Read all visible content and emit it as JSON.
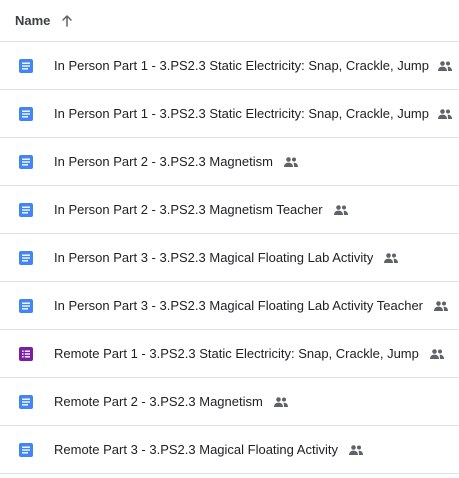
{
  "header": {
    "name_label": "Name",
    "sort_icon": "arrow-up-icon"
  },
  "colors": {
    "doc": "#4285f4",
    "form": "#7b1fa2",
    "shared": "#5f6368",
    "divider": "#e0e0e0"
  },
  "files": [
    {
      "name": "In Person Part 1 - 3.PS2.3 Static Electricity: Snap, Crackle, Jump",
      "type": "doc",
      "shared": true,
      "truncated": true
    },
    {
      "name": "In Person Part 1 - 3.PS2.3 Static Electricity: Snap, Crackle, Jump",
      "type": "doc",
      "shared": true,
      "truncated": true
    },
    {
      "name": "In Person Part 2 - 3.PS2.3 Magnetism",
      "type": "doc",
      "shared": true,
      "truncated": false
    },
    {
      "name": "In Person Part 2 - 3.PS2.3 Magnetism Teacher",
      "type": "doc",
      "shared": true,
      "truncated": false
    },
    {
      "name": "In Person Part 3 - 3.PS2.3 Magical Floating Lab Activity",
      "type": "doc",
      "shared": true,
      "truncated": false
    },
    {
      "name": "In Person Part 3 - 3.PS2.3 Magical Floating Lab Activity Teacher",
      "type": "doc",
      "shared": true,
      "truncated": false
    },
    {
      "name": "Remote Part 1 - 3.PS2.3 Static Electricity: Snap, Crackle, Jump",
      "type": "form",
      "shared": true,
      "truncated": false
    },
    {
      "name": "Remote Part 2 - 3.PS2.3 Magnetism",
      "type": "doc",
      "shared": true,
      "truncated": false
    },
    {
      "name": "Remote Part 3 - 3.PS2.3 Magical Floating Activity",
      "type": "doc",
      "shared": true,
      "truncated": false
    }
  ]
}
